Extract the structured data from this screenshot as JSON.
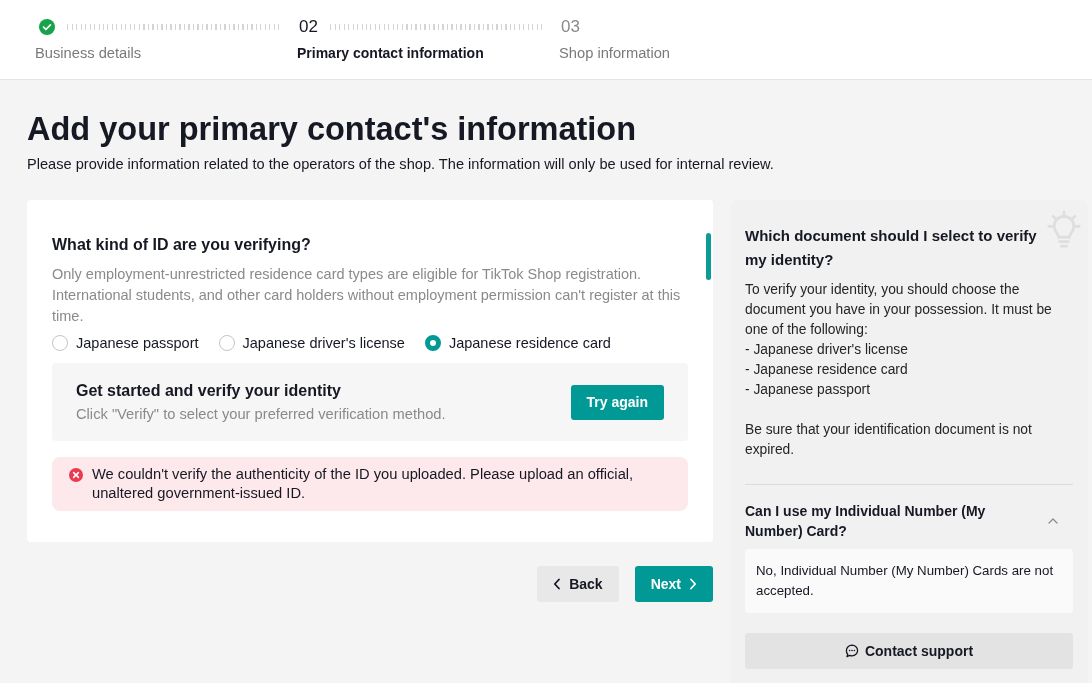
{
  "stepper": {
    "steps": [
      {
        "completed": true,
        "selected": false,
        "label": "Business details"
      },
      {
        "number": "02",
        "completed": false,
        "selected": true,
        "label": "Primary contact information"
      },
      {
        "number": "03",
        "completed": false,
        "selected": false,
        "label": "Shop information"
      }
    ]
  },
  "page": {
    "title": "Add your primary contact's information",
    "subtitle": "Please provide information related to the operators of the shop. The information will only be used for internal review."
  },
  "id_form": {
    "question": "What kind of ID are you verifying?",
    "description": "Only employment-unrestricted residence card types are eligible for TikTok Shop registration. International students, and other card holders without employment permission can't register at this time.",
    "options": [
      {
        "label": "Japanese passport",
        "selected": false
      },
      {
        "label": "Japanese driver's license",
        "selected": false
      },
      {
        "label": "Japanese residence card",
        "selected": true
      }
    ],
    "verify_box": {
      "title": "Get started and verify your identity",
      "subtitle": "Click \"Verify\" to select your preferred verification method.",
      "button": "Try again"
    },
    "error": {
      "message": "We couldn't verify the authenticity of the ID you uploaded. Please upload an official, unaltered government-issued ID."
    }
  },
  "navigation": {
    "back": "Back",
    "next": "Next"
  },
  "help_panel": {
    "title": "Which document should I select to verify my identity?",
    "intro": "To verify your identity, you should choose the document you have in your possession. It must be one of the following:",
    "list": [
      "- Japanese driver's license",
      "- Japanese residence card",
      "- Japanese passport"
    ],
    "note": "Be sure that your identification document is not expired.",
    "faq": [
      {
        "question": "Can I use my Individual Number (My Number) Card?",
        "expanded": true,
        "answer": "No, Individual Number (My Number) Cards are not accepted."
      }
    ],
    "contact_button": "Contact support"
  }
}
